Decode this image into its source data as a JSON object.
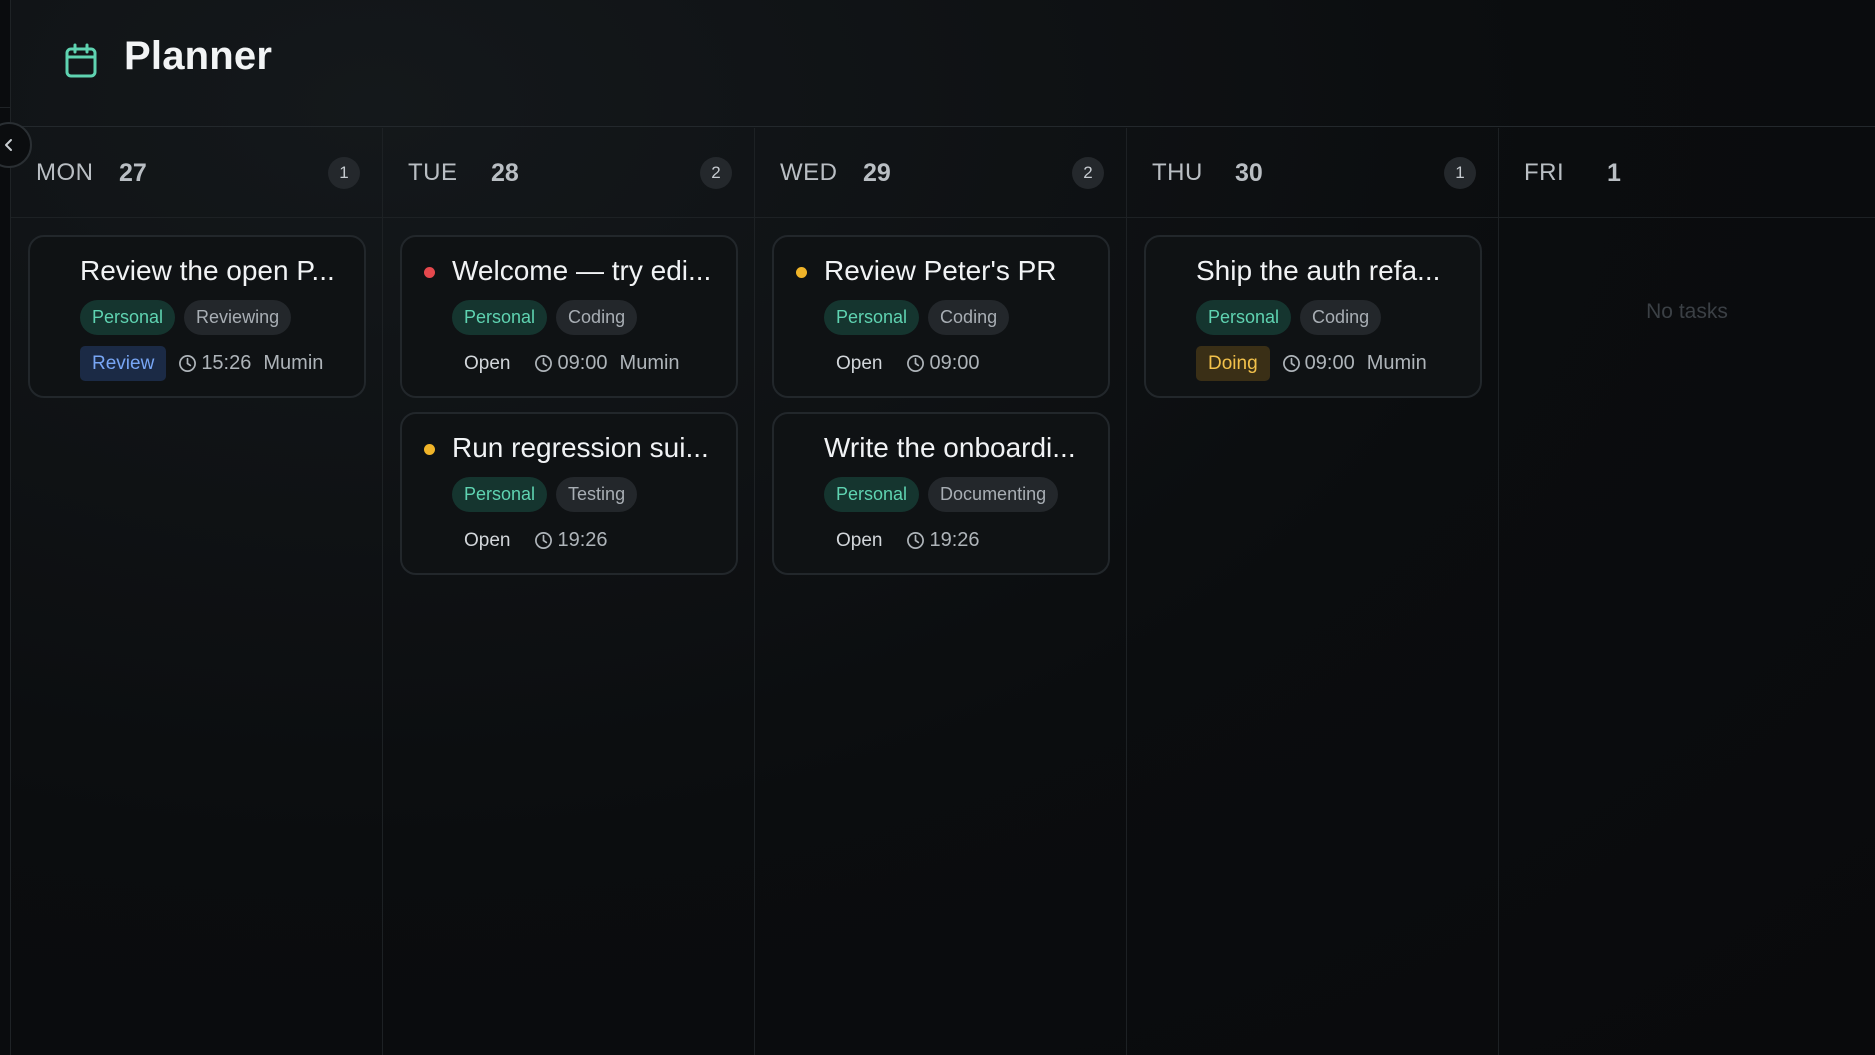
{
  "app": {
    "title": "Planner"
  },
  "colors": {
    "accent": "#5fd3b1",
    "dot_red": "#e5484d",
    "dot_amber": "#f0b429",
    "review": "#78a6f5",
    "doing": "#f2c14b"
  },
  "icons": {
    "header": "calendar-icon",
    "collapse": "chevron-left-icon",
    "time": "clock-icon"
  },
  "columns": [
    {
      "dow": "MON",
      "day": "27",
      "count": "1",
      "cards": [
        {
          "title": "Review the open P...",
          "tag1": "Personal",
          "tag2": "Reviewing",
          "status": "Review",
          "time": "15:26",
          "owner": "Mumin",
          "dot": ""
        }
      ]
    },
    {
      "dow": "TUE",
      "day": "28",
      "count": "2",
      "cards": [
        {
          "title": "Welcome — try edi...",
          "tag1": "Personal",
          "tag2": "Coding",
          "status": "Open",
          "time": "09:00",
          "owner": "Mumin",
          "dot": "red"
        },
        {
          "title": "Run regression sui...",
          "tag1": "Personal",
          "tag2": "Testing",
          "status": "Open",
          "time": "19:26",
          "owner": "",
          "dot": "amber"
        }
      ]
    },
    {
      "dow": "WED",
      "day": "29",
      "count": "2",
      "cards": [
        {
          "title": "Review Peter's PR",
          "tag1": "Personal",
          "tag2": "Coding",
          "status": "Open",
          "time": "09:00",
          "owner": "",
          "dot": "amber"
        },
        {
          "title": "Write the onboardi...",
          "tag1": "Personal",
          "tag2": "Documenting",
          "status": "Open",
          "time": "19:26",
          "owner": "",
          "dot": ""
        }
      ]
    },
    {
      "dow": "THU",
      "day": "30",
      "count": "1",
      "cards": [
        {
          "title": "Ship the auth refa...",
          "tag1": "Personal",
          "tag2": "Coding",
          "status": "Doing",
          "time": "09:00",
          "owner": "Mumin",
          "dot": ""
        }
      ]
    },
    {
      "dow": "FRI",
      "day": "1",
      "count": "",
      "empty_text": "No tasks",
      "cards": []
    }
  ]
}
